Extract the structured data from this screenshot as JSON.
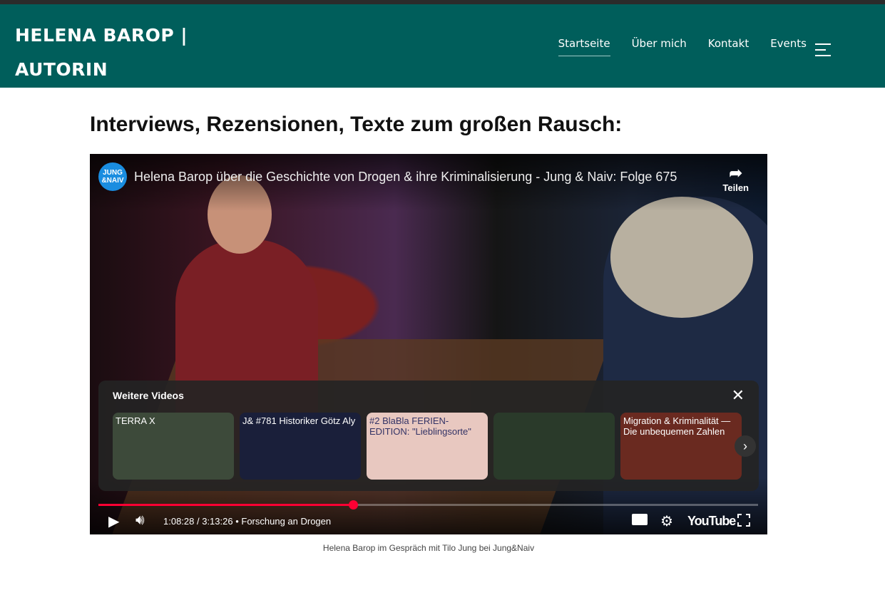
{
  "site": {
    "logo_line1": "HELENA BAROP |",
    "logo_line2": "AUTORIN",
    "nav": [
      {
        "label": "Startseite",
        "active": true
      },
      {
        "label": "Über mich"
      },
      {
        "label": "Kontakt"
      },
      {
        "label": "Events"
      }
    ]
  },
  "page": {
    "heading": "Interviews, Rezensionen, Texte zum großen Rausch:",
    "caption": "Helena Barop im Gespräch mit Tilo Jung bei Jung&Naiv"
  },
  "video": {
    "channel_badge": "JUNG &NAIV",
    "title": "Helena Barop über die Geschichte von Drogen & ihre Kriminalisierung - Jung & Naiv: Folge 675",
    "share_label": "Teilen",
    "more_videos_title": "Weitere Videos",
    "thumbs": [
      {
        "text": "TERRA X",
        "color": "#3d4a3a"
      },
      {
        "text": "J& #781 Historiker Götz Aly",
        "color": "#1a1f3a"
      },
      {
        "text": "#2 BlaBla FERIEN-EDITION: \"Lieblingsorte\"",
        "color": "#e8c8c0"
      },
      {
        "text": "",
        "color": "#2a3a2a"
      },
      {
        "text": "Migration & Kriminalität — Die unbequemen Zahlen",
        "color": "#6a2a20"
      }
    ],
    "current_time": "1:08:28",
    "duration": "3:13:26",
    "time_sep": " / ",
    "chapter": "Forschung an Drogen",
    "progress_fraction": 0.386,
    "youtube_label": "YouTube",
    "accent": "#ff0033"
  }
}
